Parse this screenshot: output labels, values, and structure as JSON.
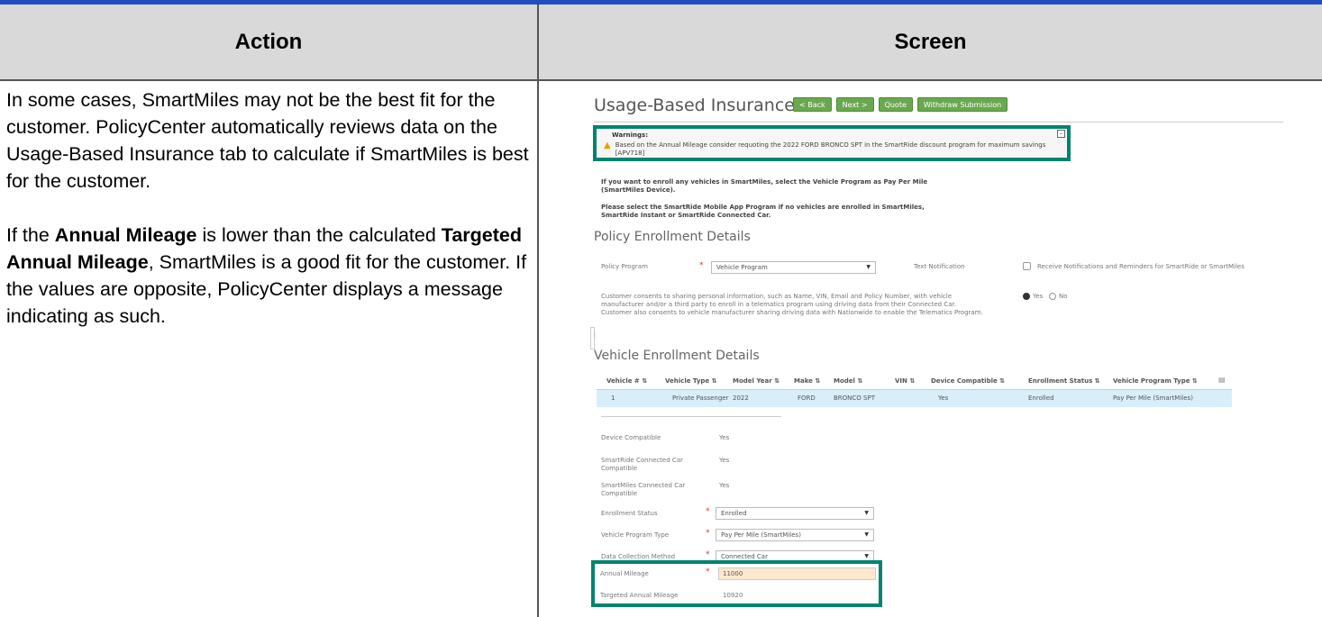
{
  "columns": {
    "action": "Action",
    "screen": "Screen"
  },
  "action": {
    "p1": "In some cases, SmartMiles may not be the best fit for the customer. PolicyCenter automatically reviews data on the Usage-Based Insurance tab to calculate if SmartMiles is best for the customer.",
    "p2_pre": "If the ",
    "p2_b1": "Annual Mileage",
    "p2_mid": " is lower than the calculated ",
    "p2_b2": "Targeted Annual Mileage",
    "p2_post": ", SmartMiles is a good fit for the customer. If the values are opposite, PolicyCenter displays a message indicating as such."
  },
  "screen": {
    "title": "Usage-Based Insurance",
    "buttons": {
      "back": "< Back",
      "next": "Next >",
      "quote": "Quote",
      "withdraw": "Withdraw Submission"
    },
    "warning": {
      "title": "Warnings:",
      "text": "Based on the Annual Mileage consider requoting the 2022 FORD BRONCO SPT in the SmartRide discount program for maximum savings [APV718]"
    },
    "info1": "If you want to enroll any vehicles in SmartMiles, select the Vehicle Program as Pay Per Mile (SmartMiles Device).",
    "info2": "Please select the SmartRide Mobile App Program if no vehicles are enrolled in SmartMiles, SmartRide Instant or SmartRide Connected Car.",
    "policy_section": "Policy Enrollment Details",
    "policy_program_label": "Policy Program",
    "policy_program_value": "Vehicle Program",
    "text_notification_label": "Text Notification",
    "receive_label": "Receive Notifications and Reminders for SmartRide or SmartMiles",
    "consent_text": "Customer consents to sharing personal information, such as Name, VIN, Email and Policy Number, with vehicle manufacturer and/or a third party to enroll in a telematics program using driving data from their Connected Car. Customer also consents to vehicle manufacturer sharing driving data with Nationwide to enable the Telematics Program.",
    "yes_label": "Yes",
    "no_label": "No",
    "vehicle_section": "Vehicle Enrollment Details",
    "vehicle_table": {
      "headers": [
        "Vehicle # ⇅",
        "Vehicle Type ⇅",
        "Model Year ⇅",
        "Make ⇅",
        "Model ⇅",
        "VIN ⇅",
        "Device Compatible ⇅",
        "Enrollment Status ⇅",
        "Vehicle Program Type ⇅"
      ],
      "row": [
        "1",
        "Private Passenger",
        "2022",
        "FORD",
        "BRONCO SPT",
        "",
        "Yes",
        "Enrolled",
        "Pay Per Mile (SmartMiles)"
      ]
    },
    "details": {
      "device_compatible_label": "Device Compatible",
      "device_compatible_value": "Yes",
      "connected_car_label": "SmartRide Connected Car Compatible",
      "connected_car_value": "Yes",
      "smartmiles_cc_label": "SmartMiles Connected Car Compatible",
      "smartmiles_cc_value": "Yes",
      "enrollment_status_label": "Enrollment Status",
      "enrollment_status_value": "Enrolled",
      "program_type_label": "Vehicle Program Type",
      "program_type_value": "Pay Per Mile (SmartMiles)",
      "collection_label": "Data Collection Method",
      "collection_value": "Connected Car",
      "annual_mileage_label": "Annual Mileage",
      "annual_mileage_value": "11000",
      "targeted_label": "Targeted Annual Mileage",
      "targeted_value": "10920"
    }
  },
  "colors": {
    "accent": "#008470",
    "header_bar": "#1f4fc0",
    "button": "#6aa84f"
  }
}
